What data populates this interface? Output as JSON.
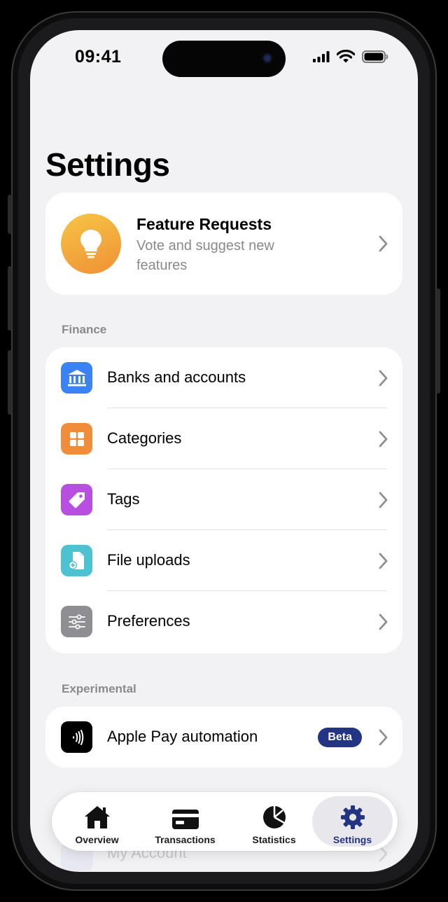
{
  "status_bar": {
    "time": "09:41"
  },
  "page_title": "Settings",
  "feature_card": {
    "title": "Feature Requests",
    "subtitle": "Vote and suggest new features",
    "icon": "lightbulb-icon"
  },
  "sections": {
    "finance": {
      "label": "Finance",
      "items": [
        {
          "label": "Banks and accounts",
          "icon": "bank-icon",
          "color": "#3b82f6"
        },
        {
          "label": "Categories",
          "icon": "grid-icon",
          "color": "#ef8d3a"
        },
        {
          "label": "Tags",
          "icon": "tag-icon",
          "color": "#b94fe0"
        },
        {
          "label": "File uploads",
          "icon": "file-upload-icon",
          "color": "#4fc2d2"
        },
        {
          "label": "Preferences",
          "icon": "sliders-icon",
          "color": "#8e8e93"
        }
      ]
    },
    "experimental": {
      "label": "Experimental",
      "items": [
        {
          "label": "Apple Pay automation",
          "icon": "contactless-icon",
          "color": "#000000",
          "badge": "Beta"
        }
      ]
    }
  },
  "hidden_row": {
    "label": "My Account"
  },
  "tabbar": {
    "tabs": [
      {
        "label": "Overview",
        "icon": "home-icon"
      },
      {
        "label": "Transactions",
        "icon": "card-icon"
      },
      {
        "label": "Statistics",
        "icon": "pie-chart-icon"
      },
      {
        "label": "Settings",
        "icon": "gear-icon",
        "active": true
      }
    ]
  },
  "colors": {
    "accent": "#223482",
    "background": "#f2f2f4"
  }
}
